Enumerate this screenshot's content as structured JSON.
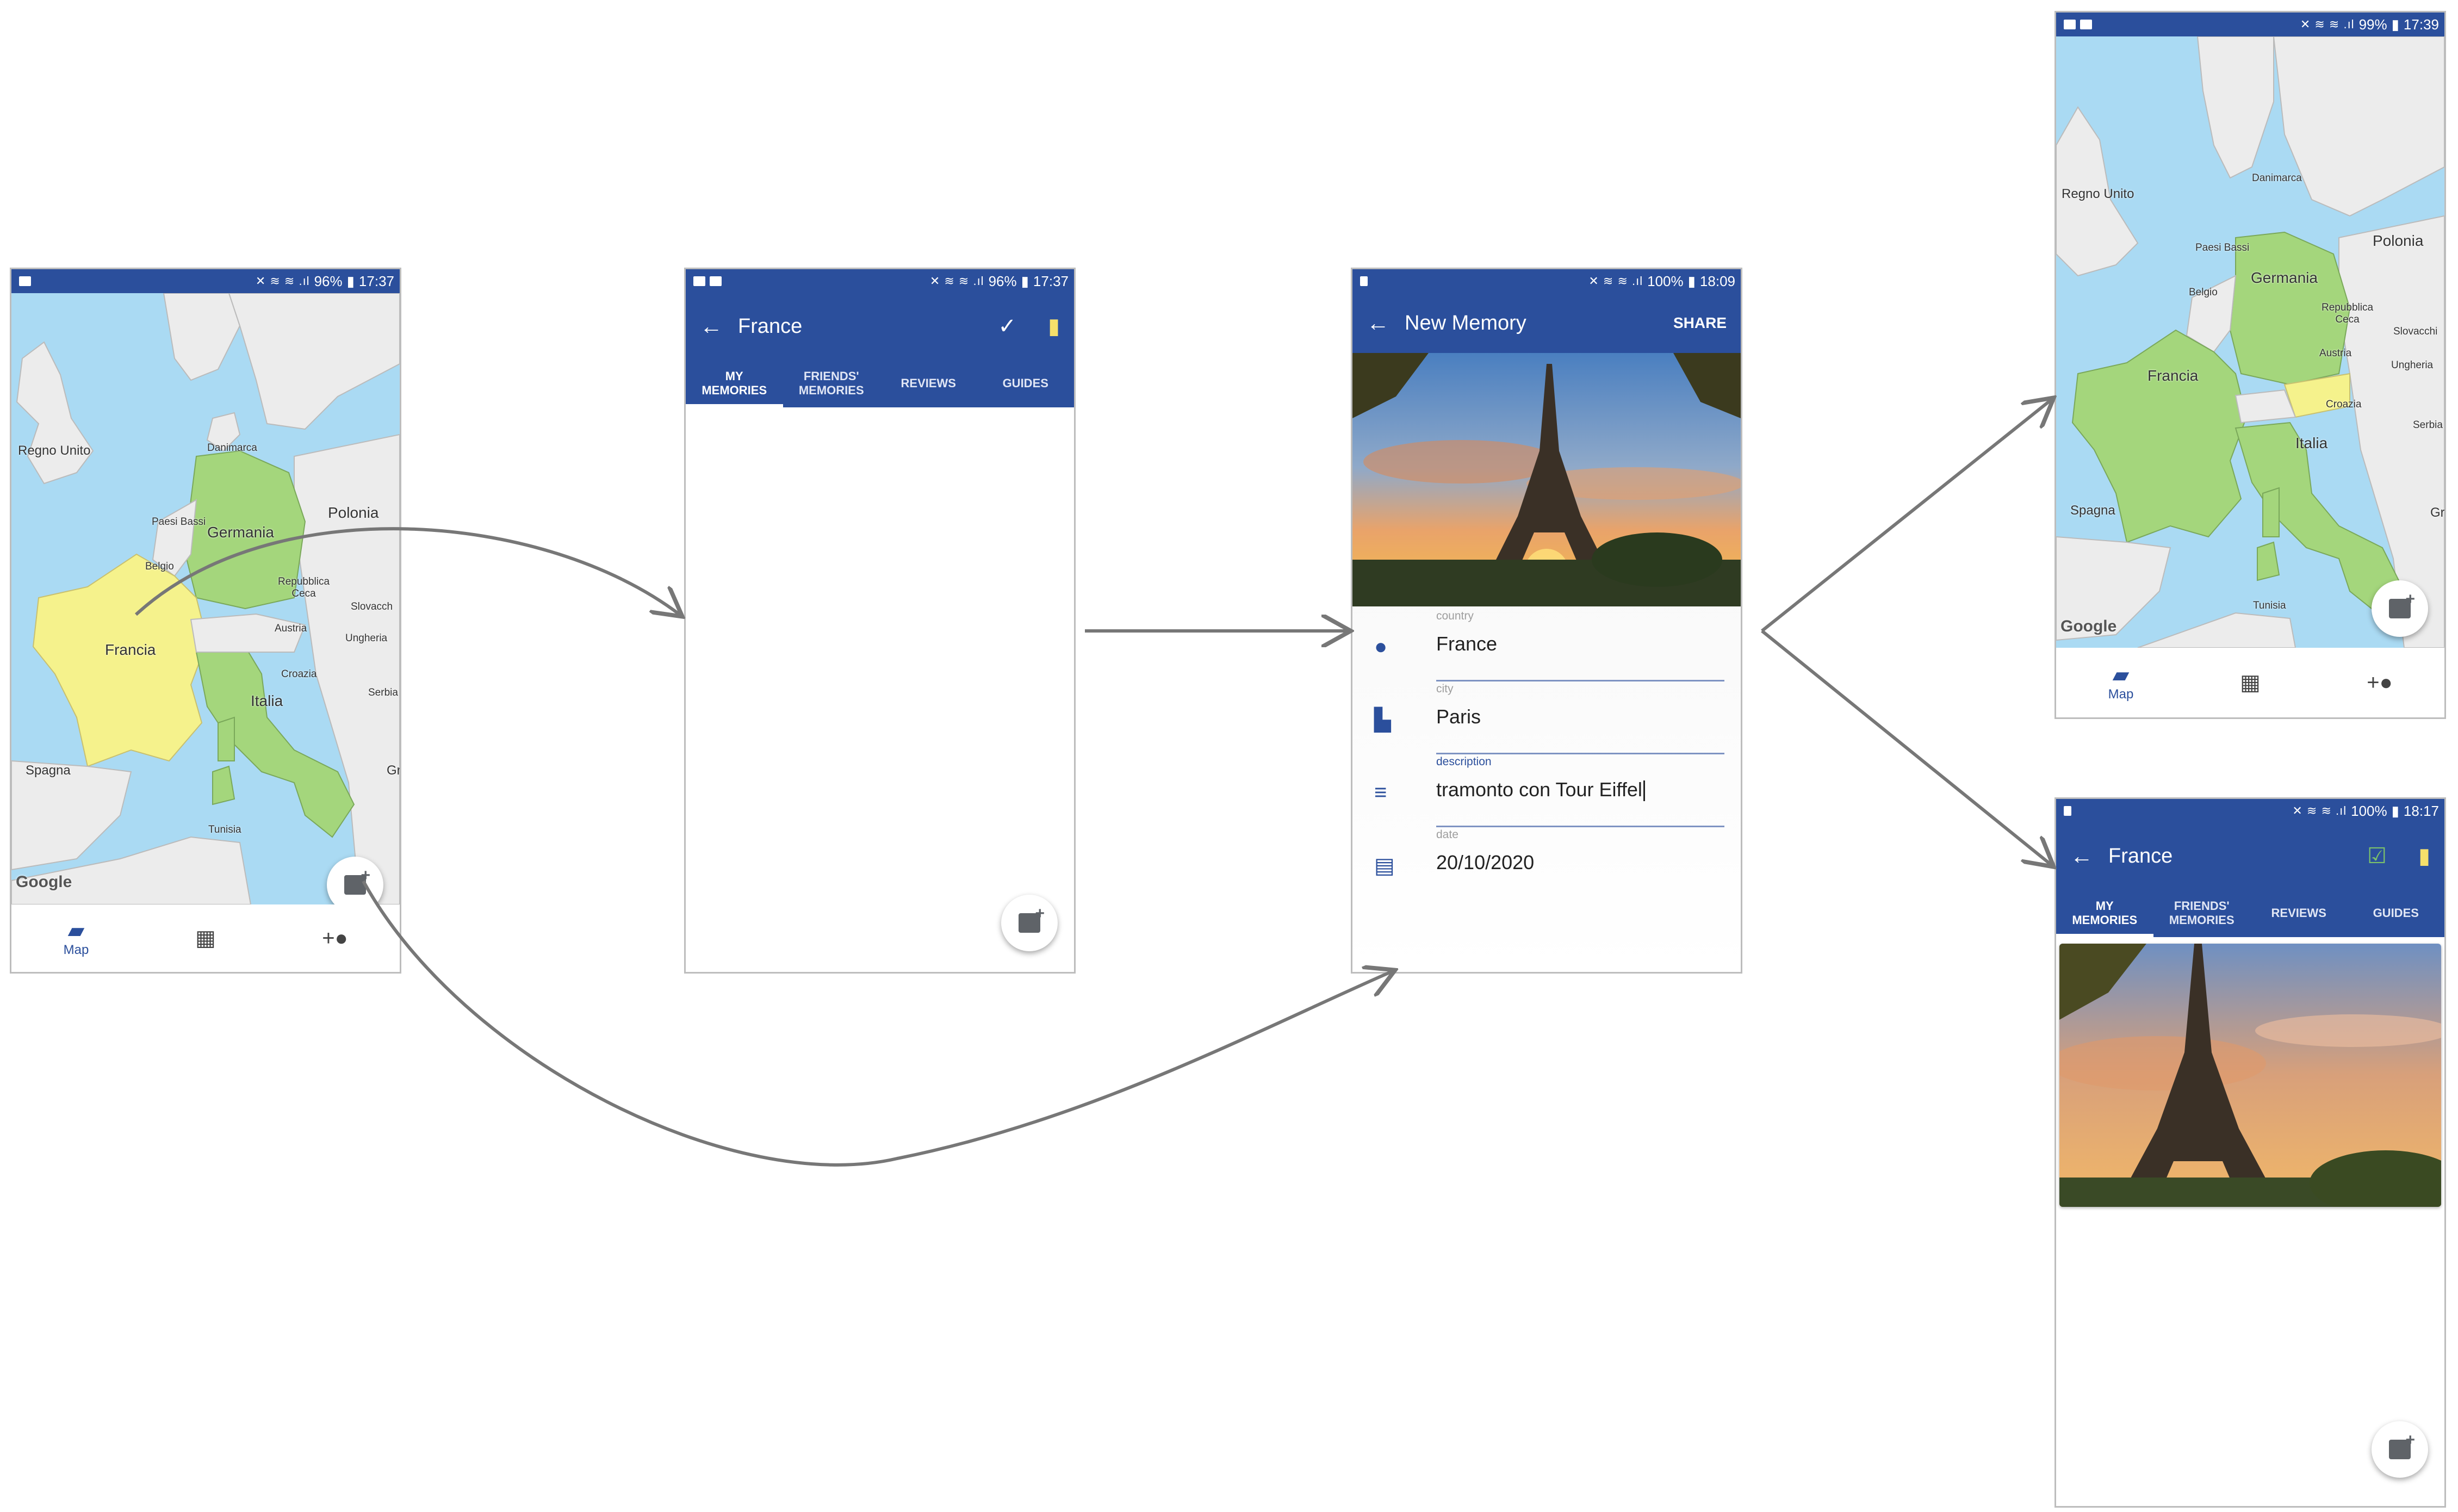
{
  "colors": {
    "primary": "#2b4f9c",
    "map_sea": "#aadaf3",
    "land": "#ececec",
    "visited": "#a4d67c",
    "selected": "#f5f28c"
  },
  "screen1": {
    "status": {
      "battery": "96%",
      "time": "17:37"
    },
    "map_labels": {
      "regno_unito": "Regno Unito",
      "danimarca": "Danimarca",
      "paesi_bassi": "Paesi Bassi",
      "germania": "Germania",
      "polonia": "Polonia",
      "belgio": "Belgio",
      "repubblica_ceca": "Repubblica\nCeca",
      "slovacchia": "Slovacch",
      "austria": "Austria",
      "ungheria": "Ungheria",
      "francia": "Francia",
      "croazia": "Croazia",
      "serbia": "Serbia",
      "italia": "Italia",
      "spagna": "Spagna",
      "tunisia": "Tunisia",
      "grecia": "Gr"
    },
    "google": "Google",
    "bottom_nav": {
      "map_label": "Map",
      "map_icon": "map-icon",
      "dashboard_icon": "dashboard-icon",
      "add_friend_icon": "person-add-icon"
    }
  },
  "screen2": {
    "status": {
      "battery": "96%",
      "time": "17:37"
    },
    "title": "France",
    "tabs": [
      "MY\nMEMORIES",
      "FRIENDS'\nMEMORIES",
      "REVIEWS",
      "GUIDES"
    ]
  },
  "screen3": {
    "status": {
      "battery": "100%",
      "time": "18:09"
    },
    "title": "New Memory",
    "share": "SHARE",
    "fields": {
      "country": {
        "label": "country",
        "value": "France"
      },
      "city": {
        "label": "city",
        "value": "Paris"
      },
      "description": {
        "label": "description",
        "value": "tramonto con Tour Eiffel"
      },
      "date": {
        "label": "date",
        "value": "20/10/2020"
      }
    }
  },
  "screen4": {
    "status": {
      "battery": "99%",
      "time": "17:39"
    },
    "map_labels": {
      "regno_unito": "Regno Unito",
      "danimarca": "Danimarca",
      "paesi_bassi": "Paesi Bassi",
      "germania": "Germania",
      "polonia": "Polonia",
      "belgio": "Belgio",
      "repubblica_ceca": "Repubblica\nCeca",
      "slovacchia": "Slovacchi",
      "austria": "Austria",
      "ungheria": "Ungheria",
      "francia": "Francia",
      "croazia": "Croazia",
      "serbia": "Serbia",
      "italia": "Italia",
      "spagna": "Spagna",
      "tunisia": "Tunisia",
      "grecia": "Gr"
    },
    "google": "Google",
    "bottom_nav": {
      "map_label": "Map"
    }
  },
  "screen5": {
    "status": {
      "battery": "100%",
      "time": "18:17"
    },
    "title": "France",
    "tabs": [
      "MY\nMEMORIES",
      "FRIENDS'\nMEMORIES",
      "REVIEWS",
      "GUIDES"
    ]
  }
}
